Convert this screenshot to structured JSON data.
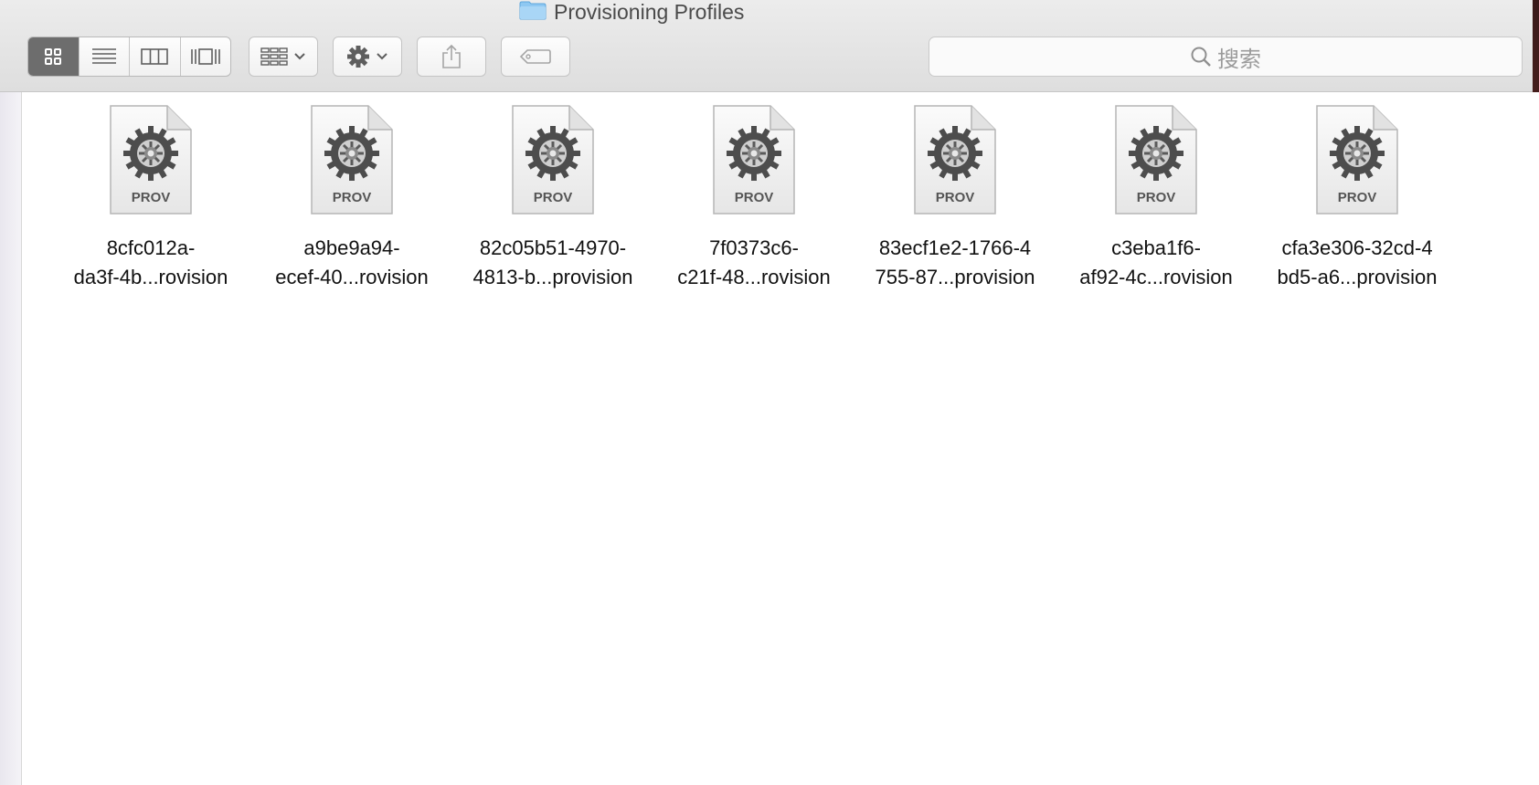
{
  "window": {
    "title": "Provisioning Profiles"
  },
  "toolbar": {
    "view_modes": [
      "icon-view",
      "list-view",
      "column-view",
      "cover-flow-view"
    ],
    "active_view": "icon-view",
    "search_placeholder": "搜索"
  },
  "files": [
    {
      "line1": "8cfc012a-",
      "line2": "da3f-4b...rovision",
      "badge": "PROV"
    },
    {
      "line1": "a9be9a94-",
      "line2": "ecef-40...rovision",
      "badge": "PROV"
    },
    {
      "line1": "82c05b51-4970-",
      "line2": "4813-b...provision",
      "badge": "PROV"
    },
    {
      "line1": "7f0373c6-",
      "line2": "c21f-48...rovision",
      "badge": "PROV"
    },
    {
      "line1": "83ecf1e2-1766-4",
      "line2": "755-87...provision",
      "badge": "PROV"
    },
    {
      "line1": "c3eba1f6-",
      "line2": "af92-4c...rovision",
      "badge": "PROV"
    },
    {
      "line1": "cfa3e306-32cd-4",
      "line2": "bd5-a6...provision",
      "badge": "PROV"
    }
  ]
}
